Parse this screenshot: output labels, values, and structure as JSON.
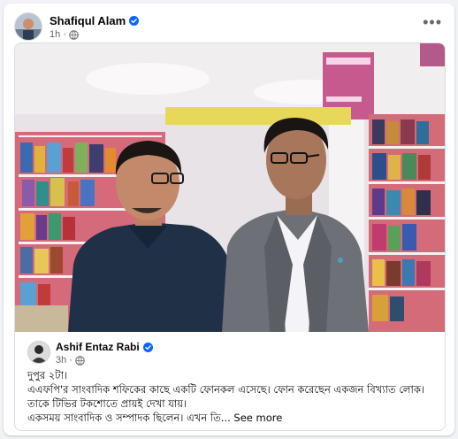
{
  "post": {
    "author": "Shafiqul Alam",
    "time": "1h",
    "more_icon": "more-horizontal-icon",
    "verified_color": "#0866ff"
  },
  "shared_post": {
    "author": "Ashif Entaz Rabi",
    "time": "3h",
    "text_line1": "দুপুর ২টা।",
    "text_line2": "এএফপি'র সাংবাদিক শফিকের কাছে একটি ফোনকল এসেছে। ফোন করেছেন একজন বিখ্যাত লোক।",
    "text_line3": "তাকে টিভির টকশোতে প্রায়ই দেখা যায়।",
    "text_line4": "একসময় সাংবাদিক ও সম্পাদক ছিলেন। এখন তি...",
    "see_more": "See more"
  }
}
